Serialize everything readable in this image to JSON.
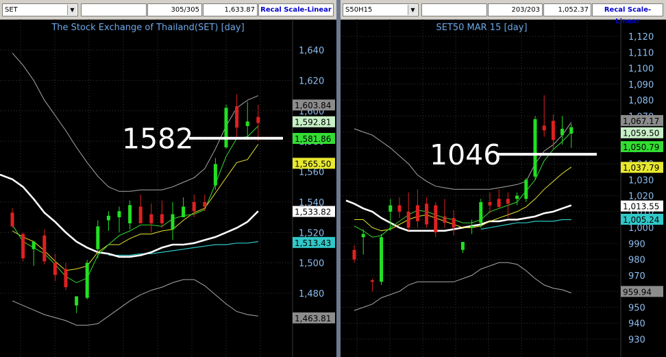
{
  "colors": {
    "up": "#22e022",
    "down": "#e02020",
    "grid": "#3a3a3a",
    "axis": "#8fbef0",
    "envelope": "#aaaaaa",
    "ma_fast": "#33dd33",
    "ma_mid": "#e8e830",
    "ma_white": "#ffffff",
    "ma_cyan": "#30c8c8",
    "annot": "#ffffff"
  },
  "panels": [
    {
      "toolbar": {
        "symbol": "SET",
        "bars": "305/305",
        "last": "1,633.87",
        "button": "Recal Scale-Linear"
      },
      "chart_data": {
        "type": "candlestick",
        "title": "The Stock Exchange of Thailand(SET) [day]",
        "ylim": [
          1458,
          1652
        ],
        "yticks": [
          1480,
          1500,
          1520,
          1540,
          1560,
          1580,
          1600,
          1620,
          1640
        ],
        "ytick_labels": [
          "1,480",
          "1,500",
          "1,520",
          "1,540",
          "1,560",
          "1,580",
          "1,600",
          "1,620",
          "1,640"
        ],
        "candles": [
          {
            "o": 1533,
            "h": 1536,
            "l": 1523,
            "c": 1524
          },
          {
            "o": 1519,
            "h": 1520,
            "l": 1501,
            "c": 1503
          },
          {
            "o": 1509,
            "h": 1512,
            "l": 1498,
            "c": 1514
          },
          {
            "o": 1518,
            "h": 1522,
            "l": 1499,
            "c": 1501
          },
          {
            "o": 1500,
            "h": 1506,
            "l": 1488,
            "c": 1492
          },
          {
            "o": 1496,
            "h": 1500,
            "l": 1482,
            "c": 1484
          },
          {
            "o": 1472,
            "h": 1478,
            "l": 1467,
            "c": 1478
          },
          {
            "o": 1477,
            "h": 1502,
            "l": 1476,
            "c": 1500
          },
          {
            "o": 1509,
            "h": 1528,
            "l": 1503,
            "c": 1524
          },
          {
            "o": 1528,
            "h": 1534,
            "l": 1521,
            "c": 1531
          },
          {
            "o": 1530,
            "h": 1537,
            "l": 1520,
            "c": 1534
          },
          {
            "o": 1526,
            "h": 1541,
            "l": 1522,
            "c": 1538
          },
          {
            "o": 1537,
            "h": 1545,
            "l": 1526,
            "c": 1526
          },
          {
            "o": 1532,
            "h": 1539,
            "l": 1520,
            "c": 1526
          },
          {
            "o": 1532,
            "h": 1541,
            "l": 1523,
            "c": 1526
          },
          {
            "o": 1522,
            "h": 1540,
            "l": 1515,
            "c": 1532
          },
          {
            "o": 1530,
            "h": 1543,
            "l": 1530,
            "c": 1537
          },
          {
            "o": 1540,
            "h": 1545,
            "l": 1530,
            "c": 1534
          },
          {
            "o": 1540,
            "h": 1545,
            "l": 1534,
            "c": 1537
          },
          {
            "o": 1551,
            "h": 1569,
            "l": 1548,
            "c": 1565
          },
          {
            "o": 1576,
            "h": 1604,
            "l": 1575,
            "c": 1602
          },
          {
            "o": 1603,
            "h": 1611,
            "l": 1582,
            "c": 1589
          },
          {
            "o": 1590,
            "h": 1606,
            "l": 1581,
            "c": 1593
          },
          {
            "o": 1596,
            "h": 1604,
            "l": 1580,
            "c": 1592
          }
        ],
        "lines": {
          "env_upper": [
            1638,
            1630,
            1620,
            1607,
            1597,
            1587,
            1576,
            1566,
            1557,
            1550,
            1547,
            1547,
            1548,
            1548,
            1548,
            1550,
            1553,
            1556,
            1562,
            1575,
            1590,
            1602,
            1607,
            1610
          ],
          "env_lower": [
            1475,
            1472,
            1469,
            1466,
            1464,
            1462,
            1459,
            1459,
            1460,
            1465,
            1470,
            1475,
            1479,
            1482,
            1484,
            1487,
            1489,
            1489,
            1485,
            1479,
            1473,
            1468,
            1466,
            1465
          ],
          "ma_fast": [
            1525,
            1514,
            1510,
            1506,
            1499,
            1491,
            1487,
            1490,
            1505,
            1512,
            1518,
            1521,
            1525,
            1525,
            1524,
            1529,
            1531,
            1532,
            1535,
            1552,
            1570,
            1582,
            1583,
            1590
          ],
          "ma_mid": [
            1521,
            1517,
            1514,
            1508,
            1501,
            1495,
            1496,
            1498,
            1507,
            1512,
            1512,
            1516,
            1519,
            1519,
            1521,
            1522,
            1528,
            1533,
            1536,
            1546,
            1556,
            1566,
            1568,
            1578
          ],
          "ma_white": [
            1555,
            1550,
            1542,
            1533,
            1527,
            1520,
            1514,
            1510,
            1507,
            1506,
            1504,
            1504,
            1505,
            1507,
            1510,
            1512,
            1512,
            1513,
            1515,
            1517,
            1520,
            1523,
            1527,
            1534
          ],
          "ma_cyan": [
            null,
            null,
            null,
            null,
            null,
            null,
            null,
            null,
            null,
            1505,
            1505,
            1505,
            1506,
            1506,
            1507,
            1508,
            1509,
            1510,
            1511,
            1512,
            1512,
            1513,
            1513,
            1514
          ]
        },
        "tags": [
          {
            "value": "1,603.84",
            "y": 1603.84,
            "bg": "#8c8c8c",
            "fg": "#000000"
          },
          {
            "value": "1,592.81",
            "y": 1592.81,
            "bg": "#c8f0c8",
            "fg": "#000000"
          },
          {
            "value": "1,581.86",
            "y": 1581.86,
            "bg": "#33dd33",
            "fg": "#000000"
          },
          {
            "value": "1,565.50",
            "y": 1565.5,
            "bg": "#e8e830",
            "fg": "#000000"
          },
          {
            "value": "1,533.82",
            "y": 1533.82,
            "bg": "#ffffff",
            "fg": "#000000"
          },
          {
            "value": "1,513.43",
            "y": 1513.43,
            "bg": "#30c8c8",
            "fg": "#000000"
          },
          {
            "value": "1,463.81",
            "y": 1463.81,
            "bg": "#8c8c8c",
            "fg": "#000000"
          }
        ],
        "annotation": {
          "text": "1582",
          "y": 1582
        }
      }
    },
    {
      "toolbar": {
        "symbol": "S50H15",
        "bars": "203/203",
        "last": "1,052.37",
        "button": "Recal Scale-Linear"
      },
      "chart_data": {
        "type": "candlestick",
        "title": "SET50 MAR 15  [day]",
        "ylim": [
          922,
          1131
        ],
        "yticks": [
          930,
          940,
          950,
          960,
          970,
          980,
          990,
          1000,
          1010,
          1020,
          1030,
          1040,
          1050,
          1060,
          1070,
          1080,
          1090,
          1100,
          1110,
          1120
        ],
        "ytick_labels": [
          "930",
          "940",
          "950",
          "960",
          "970",
          "980",
          "990",
          "1,000",
          "1,010",
          "1,020",
          "1,030",
          "1,040",
          "1,050",
          "1,060",
          "1,070",
          "1,080",
          "1,090",
          "1,100",
          "1,110",
          "1,120"
        ],
        "candles": [
          {
            "o": 986,
            "h": 989,
            "l": 978,
            "c": 980
          },
          {
            "o": 994,
            "h": 999,
            "l": 983,
            "c": 996
          },
          {
            "o": 967,
            "h": 968,
            "l": 960,
            "c": 966
          },
          {
            "o": 966,
            "h": 996,
            "l": 964,
            "c": 994
          },
          {
            "o": 1010,
            "h": 1018,
            "l": 998,
            "c": 1014
          },
          {
            "o": 1014,
            "h": 1019,
            "l": 1006,
            "c": 1010
          },
          {
            "o": 1010,
            "h": 1022,
            "l": 998,
            "c": 1000
          },
          {
            "o": 1014,
            "h": 1024,
            "l": 1000,
            "c": 1004
          },
          {
            "o": 1015,
            "h": 1019,
            "l": 1000,
            "c": 1002
          },
          {
            "o": 1014,
            "h": 1016,
            "l": 994,
            "c": 997
          },
          {
            "o": 1007,
            "h": 1018,
            "l": 1000,
            "c": 1003
          },
          {
            "o": 1006,
            "h": 1011,
            "l": 995,
            "c": 1000
          },
          {
            "o": 986,
            "h": 991,
            "l": 984,
            "c": 991
          },
          {
            "o": 1000,
            "h": 1005,
            "l": 996,
            "c": 1001
          },
          {
            "o": 1003,
            "h": 1018,
            "l": 1000,
            "c": 1016
          },
          {
            "o": 1016,
            "h": 1022,
            "l": 1009,
            "c": 1014
          },
          {
            "o": 1018,
            "h": 1024,
            "l": 1012,
            "c": 1013
          },
          {
            "o": 1018,
            "h": 1022,
            "l": 1006,
            "c": 1015
          },
          {
            "o": 1018,
            "h": 1022,
            "l": 1014,
            "c": 1020
          },
          {
            "o": 1018,
            "h": 1031,
            "l": 1016,
            "c": 1030
          },
          {
            "o": 1032,
            "h": 1070,
            "l": 1030,
            "c": 1068
          },
          {
            "o": 1064,
            "h": 1083,
            "l": 1057,
            "c": 1061
          },
          {
            "o": 1067,
            "h": 1071,
            "l": 1049,
            "c": 1055
          },
          {
            "o": 1058,
            "h": 1070,
            "l": 1052,
            "c": 1062
          },
          {
            "o": 1059,
            "h": 1065,
            "l": 1050,
            "c": 1063
          }
        ],
        "lines": {
          "env_upper": [
            1062,
            1060,
            1058,
            1054,
            1050,
            1045,
            1040,
            1033,
            1029,
            1026,
            1025,
            1024,
            1024,
            1024,
            1024,
            1024,
            1025,
            1026,
            1027,
            1029,
            1040,
            1048,
            1052,
            1058,
            1066
          ],
          "env_lower": [
            948,
            950,
            952,
            956,
            958,
            960,
            964,
            966,
            966,
            966,
            966,
            966,
            968,
            970,
            974,
            976,
            978,
            978,
            977,
            973,
            968,
            964,
            962,
            961,
            959
          ],
          "ma_fast": [
            1001,
            998,
            994,
            995,
            1000,
            1004,
            1008,
            1011,
            1010,
            1008,
            1006,
            1005,
            1003,
            1003,
            1005,
            1010,
            1012,
            1014,
            1016,
            1023,
            1030,
            1042,
            1049,
            1054,
            1060
          ],
          "ma_mid": [
            1005,
            1005,
            1000,
            998,
            999,
            1002,
            1005,
            1007,
            1008,
            1006,
            1004,
            1002,
            1000,
            1000,
            1001,
            1004,
            1006,
            1008,
            1010,
            1013,
            1018,
            1024,
            1029,
            1034,
            1038
          ],
          "ma_white": [
            1015,
            1012,
            1010,
            1006,
            1003,
            1000,
            998,
            998,
            998,
            998,
            998,
            999,
            1000,
            1001,
            1002,
            1004,
            1004,
            1005,
            1005,
            1006,
            1007,
            1009,
            1010,
            1012,
            1014
          ],
          "ma_cyan": [
            null,
            null,
            null,
            null,
            null,
            null,
            null,
            null,
            null,
            null,
            null,
            null,
            null,
            null,
            999,
            1000,
            1001,
            1002,
            1003,
            1003,
            1004,
            1004,
            1004,
            1005,
            1005
          ]
        },
        "tags": [
          {
            "value": "1,067.17",
            "y": 1067.17,
            "bg": "#8c8c8c",
            "fg": "#000000"
          },
          {
            "value": "1,059.50",
            "y": 1059.5,
            "bg": "#c8f0c8",
            "fg": "#000000"
          },
          {
            "value": "1,050.79",
            "y": 1050.79,
            "bg": "#33dd33",
            "fg": "#000000"
          },
          {
            "value": "1,037.79",
            "y": 1037.79,
            "bg": "#e8e830",
            "fg": "#000000"
          },
          {
            "value": "1,013.55",
            "y": 1013.55,
            "bg": "#ffffff",
            "fg": "#000000"
          },
          {
            "value": "1,005.24",
            "y": 1005.24,
            "bg": "#30c8c8",
            "fg": "#000000"
          },
          {
            "value": "959.94",
            "y": 959.94,
            "bg": "#8c8c8c",
            "fg": "#000000"
          }
        ],
        "annotation": {
          "text": "1046",
          "y": 1046
        }
      }
    }
  ]
}
